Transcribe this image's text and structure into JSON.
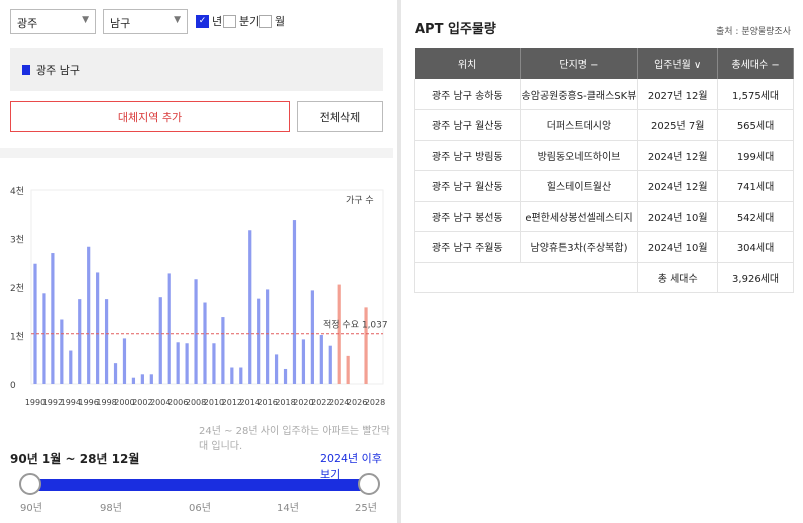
{
  "filters": {
    "city": "광주",
    "district": "남구",
    "period_options": [
      {
        "label": "년",
        "checked": true
      },
      {
        "label": "분기",
        "checked": false
      },
      {
        "label": "월",
        "checked": false
      }
    ]
  },
  "region_tag": "광주 남구",
  "buttons": {
    "add_region": "대체지역 추가",
    "delete_all": "전체삭제"
  },
  "chart_data": {
    "type": "bar",
    "y_ticks": [
      "4천",
      "3천",
      "2천",
      "1천",
      "0"
    ],
    "ylim": [
      0,
      4000
    ],
    "x_tick_labels": [
      "1990",
      "1992",
      "1994",
      "1996",
      "1998",
      "2000",
      "2002",
      "2004",
      "2006",
      "2008",
      "2010",
      "2012",
      "2014",
      "2016",
      "2018",
      "2020",
      "2022",
      "2024",
      "2026",
      "2028"
    ],
    "legend": "가구 수",
    "threshold_label": "적정 수요 1,037",
    "threshold": 1037,
    "colors": {
      "bar": "#8e9cf0",
      "future": "#f3a093",
      "threshold": "#e25b5b"
    },
    "years": [
      1990,
      1991,
      1992,
      1993,
      1994,
      1995,
      1996,
      1997,
      1998,
      1999,
      2000,
      2001,
      2002,
      2003,
      2004,
      2005,
      2006,
      2007,
      2008,
      2009,
      2010,
      2011,
      2012,
      2013,
      2014,
      2015,
      2016,
      2017,
      2018,
      2019,
      2020,
      2021,
      2022,
      2023,
      2024,
      2025,
      2026,
      2027,
      2028
    ],
    "values": [
      2480,
      1870,
      2700,
      1330,
      690,
      1750,
      2830,
      2300,
      1750,
      430,
      940,
      130,
      200,
      200,
      1790,
      2280,
      860,
      840,
      2160,
      1680,
      840,
      1380,
      340,
      340,
      3170,
      1760,
      1950,
      610,
      310,
      3380,
      920,
      1930,
      1010,
      790,
      2050,
      580,
      0,
      1580,
      0
    ],
    "future_from": 2024
  },
  "note": "24년 ~ 28년 사이 입주하는 아파트는 빨간막대 입니다.",
  "range": {
    "label": "90년 1월 ~ 28년 12월",
    "link": "2024년 이후 보기",
    "ticks": [
      "90년",
      "98년",
      "06년",
      "14년",
      "25년"
    ]
  },
  "right": {
    "title": "APT 입주물량",
    "source": "출처 : 분양물량조사",
    "headers": [
      "위치",
      "단지명 −",
      "입주년월 ∨",
      "총세대수 −"
    ],
    "rows": [
      [
        "광주 남구 송하동",
        "송암공원중흥S-클래스SK뷰",
        "2027년 12월",
        "1,575세대"
      ],
      [
        "광주 남구 월산동",
        "더퍼스트데시앙",
        "2025년 7월",
        "565세대"
      ],
      [
        "광주 남구 방림동",
        "방림동오네뜨하이브",
        "2024년 12월",
        "199세대"
      ],
      [
        "광주 남구 월산동",
        "힐스테이트월산",
        "2024년 12월",
        "741세대"
      ],
      [
        "광주 남구 봉선동",
        "e편한세상봉선셀레스티지",
        "2024년 10월",
        "542세대"
      ],
      [
        "광주 남구 주월동",
        "남양휴튼3차(주상복합)",
        "2024년 10월",
        "304세대"
      ]
    ],
    "total_label": "총 세대수",
    "total_value": "3,926세대"
  }
}
